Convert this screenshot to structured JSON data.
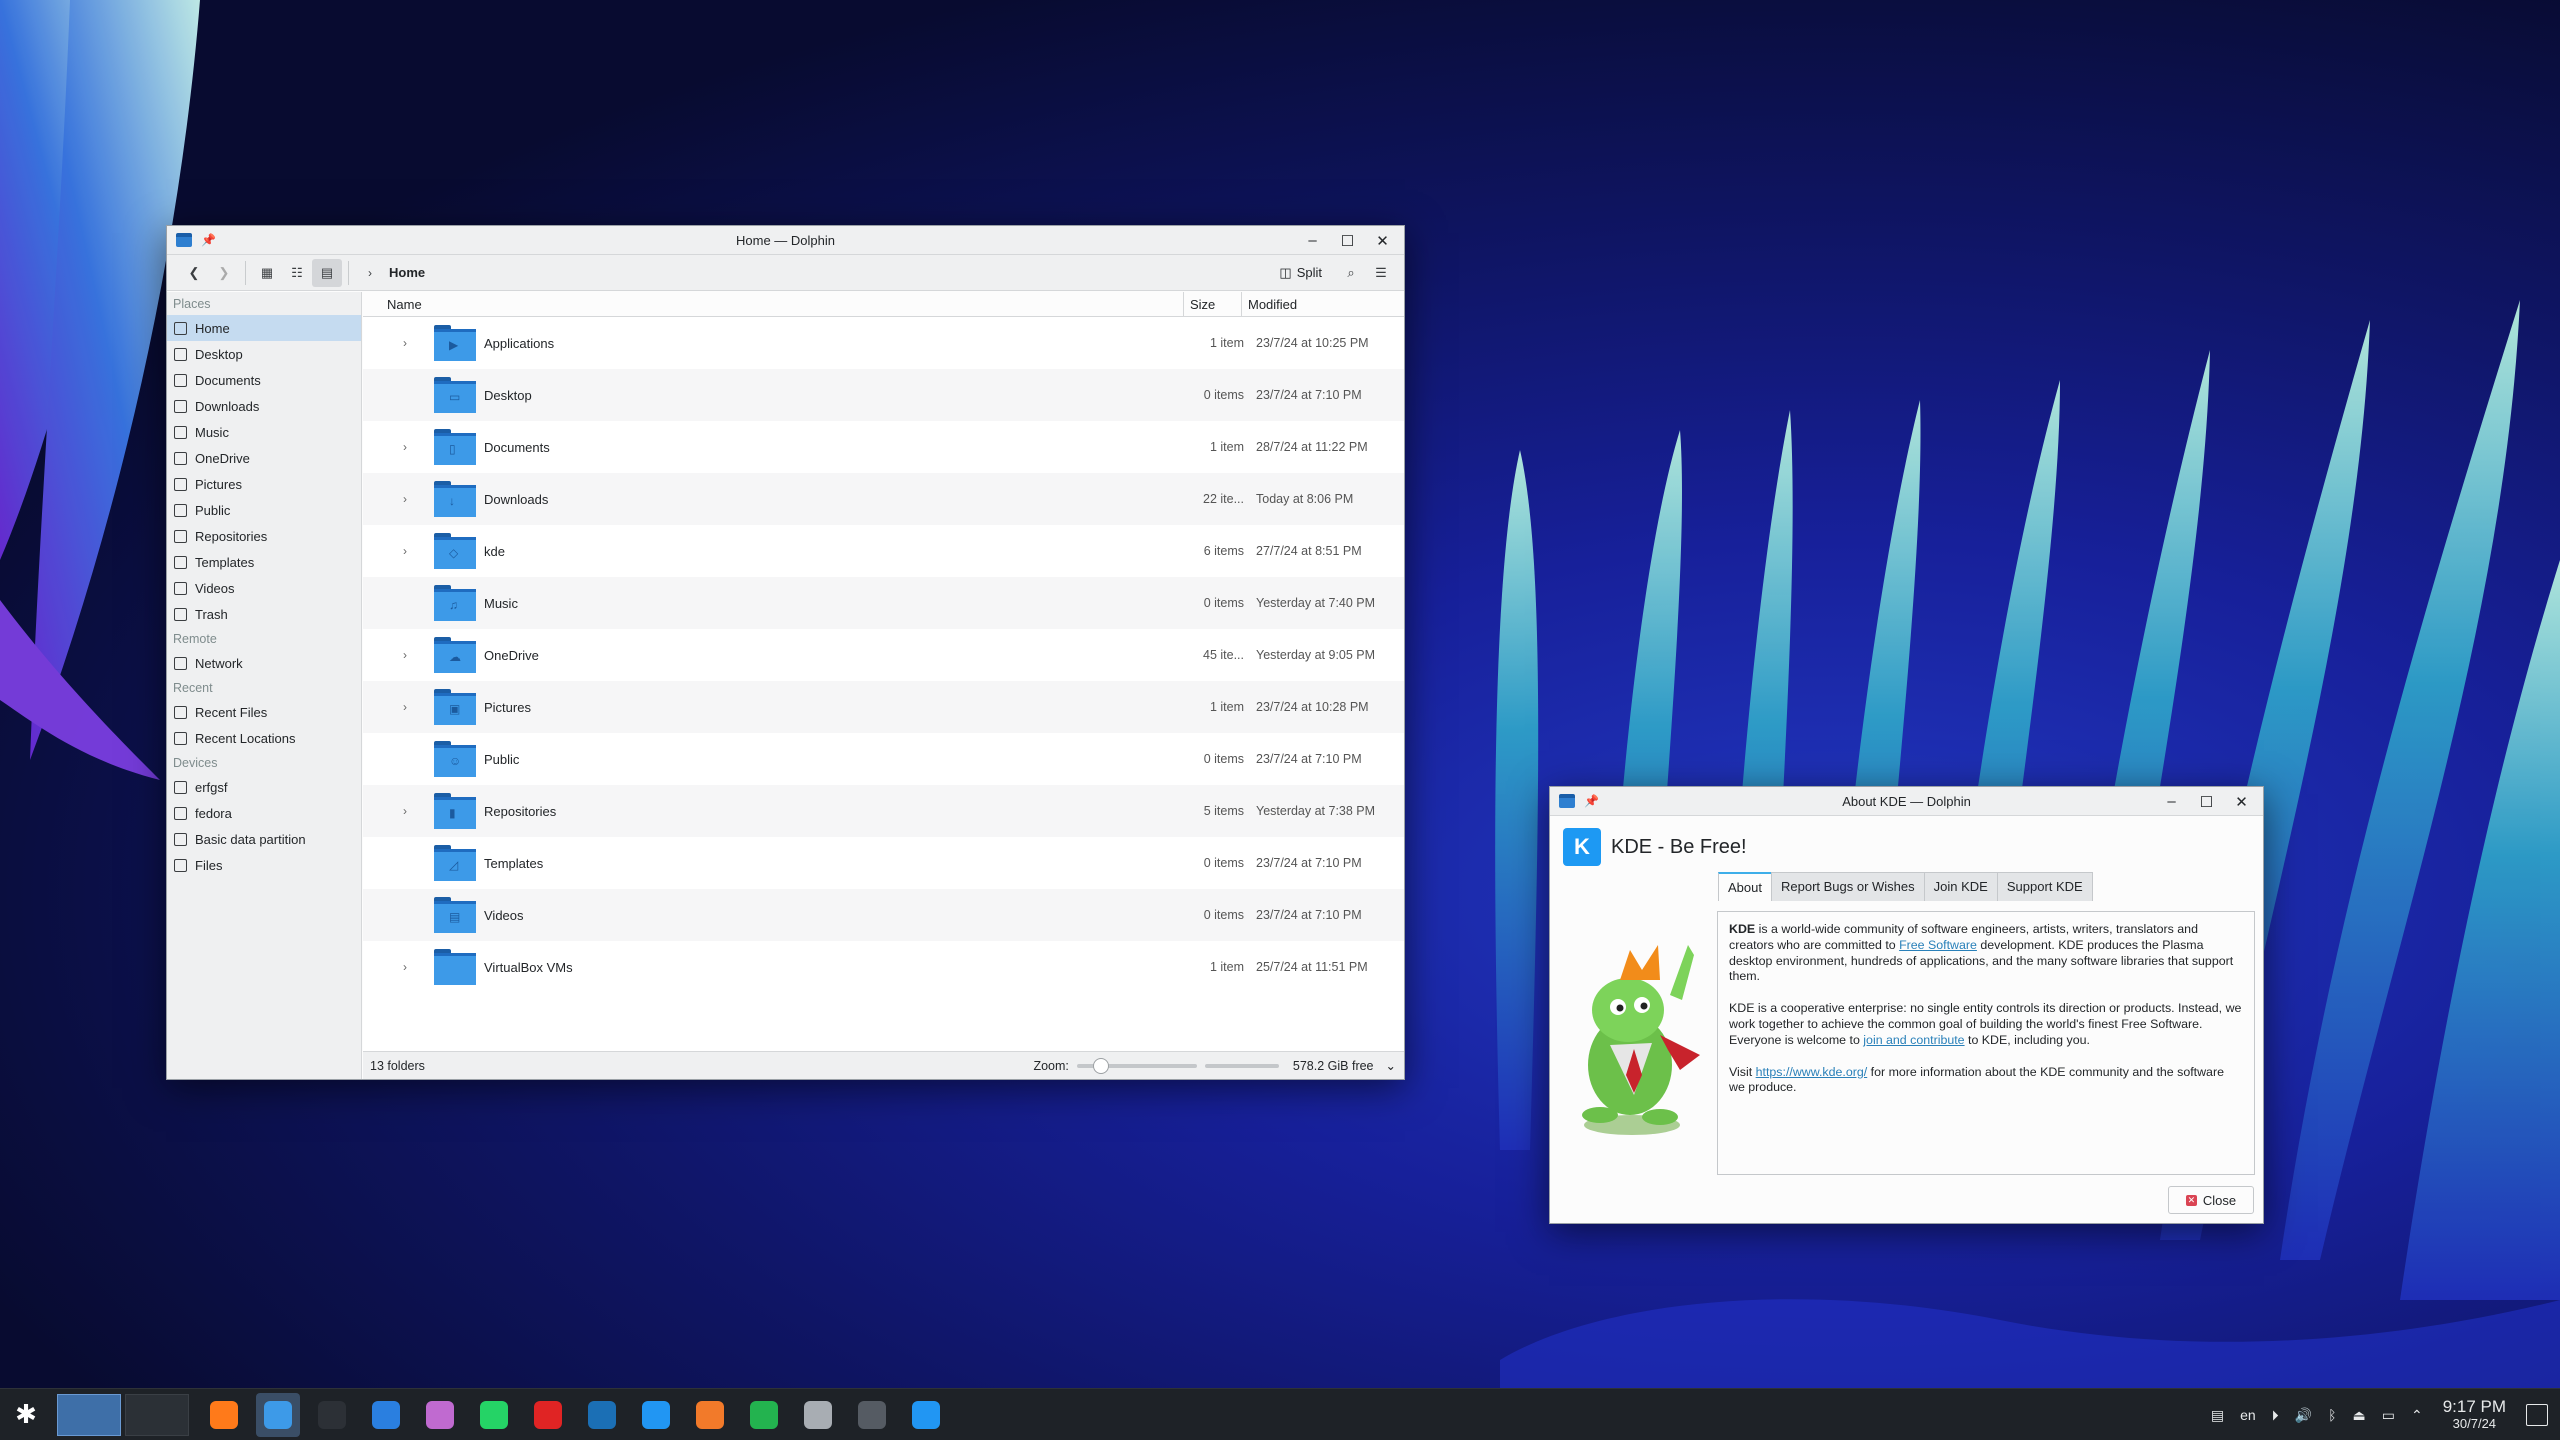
{
  "dolphin": {
    "title": "Home — Dolphin",
    "breadcrumb": "Home",
    "split_label": "Split",
    "places_header": "Places",
    "places": [
      {
        "label": "Home",
        "selected": true
      },
      {
        "label": "Desktop"
      },
      {
        "label": "Documents"
      },
      {
        "label": "Downloads"
      },
      {
        "label": "Music"
      },
      {
        "label": "OneDrive"
      },
      {
        "label": "Pictures"
      },
      {
        "label": "Public"
      },
      {
        "label": "Repositories"
      },
      {
        "label": "Templates"
      },
      {
        "label": "Videos"
      },
      {
        "label": "Trash"
      }
    ],
    "remote_header": "Remote",
    "remote": [
      {
        "label": "Network"
      }
    ],
    "recent_header": "Recent",
    "recent": [
      {
        "label": "Recent Files"
      },
      {
        "label": "Recent Locations"
      }
    ],
    "devices_header": "Devices",
    "devices": [
      {
        "label": "erfgsf"
      },
      {
        "label": "fedora"
      },
      {
        "label": "Basic data partition"
      },
      {
        "label": "Files"
      }
    ],
    "columns": {
      "name": "Name",
      "size": "Size",
      "modified": "Modified"
    },
    "files": [
      {
        "name": "Applications",
        "size": "1 item",
        "modified": "23/7/24 at 10:25 PM",
        "expandable": true,
        "glyph": "▶"
      },
      {
        "name": "Desktop",
        "size": "0 items",
        "modified": "23/7/24 at 7:10 PM",
        "expandable": false,
        "glyph": "▭"
      },
      {
        "name": "Documents",
        "size": "1 item",
        "modified": "28/7/24 at 11:22 PM",
        "expandable": true,
        "glyph": "▯"
      },
      {
        "name": "Downloads",
        "size": "22 ite...",
        "modified": "Today at 8:06 PM",
        "expandable": true,
        "glyph": "↓"
      },
      {
        "name": "kde",
        "size": "6 items",
        "modified": "27/7/24 at 8:51 PM",
        "expandable": true,
        "glyph": "◇"
      },
      {
        "name": "Music",
        "size": "0 items",
        "modified": "Yesterday at 7:40 PM",
        "expandable": false,
        "glyph": "♫"
      },
      {
        "name": "OneDrive",
        "size": "45 ite...",
        "modified": "Yesterday at 9:05 PM",
        "expandable": true,
        "glyph": "☁"
      },
      {
        "name": "Pictures",
        "size": "1 item",
        "modified": "23/7/24 at 10:28 PM",
        "expandable": true,
        "glyph": "▣"
      },
      {
        "name": "Public",
        "size": "0 items",
        "modified": "23/7/24 at 7:10 PM",
        "expandable": false,
        "glyph": "☺"
      },
      {
        "name": "Repositories",
        "size": "5 items",
        "modified": "Yesterday at 7:38 PM",
        "expandable": true,
        "glyph": "▮"
      },
      {
        "name": "Templates",
        "size": "0 items",
        "modified": "23/7/24 at 7:10 PM",
        "expandable": false,
        "glyph": "◿"
      },
      {
        "name": "Videos",
        "size": "0 items",
        "modified": "23/7/24 at 7:10 PM",
        "expandable": false,
        "glyph": "▤"
      },
      {
        "name": "VirtualBox VMs",
        "size": "1 item",
        "modified": "25/7/24 at 11:51 PM",
        "expandable": true,
        "glyph": ""
      }
    ],
    "status_count": "13 folders",
    "zoom_label": "Zoom:",
    "zoom_level": 0.15,
    "free_space": "578.2 GiB free"
  },
  "about": {
    "title": "About KDE — Dolphin",
    "heading": "KDE - Be Free!",
    "tabs": [
      "About",
      "Report Bugs or Wishes",
      "Join KDE",
      "Support KDE"
    ],
    "p1_bold": "KDE",
    "p1_a": " is a world-wide community of software engineers, artists, writers, translators and creators who are committed to ",
    "p1_link": "Free Software",
    "p1_b": " development. KDE produces the Plasma desktop environment, hundreds of applications, and the many software libraries that support them.",
    "p2_a": "KDE is a cooperative enterprise: no single entity controls its direction or products. Instead, we work together to achieve the common goal of building the world's finest Free Software. Everyone is welcome to ",
    "p2_link": "join and contribute",
    "p2_b": " to KDE, including you.",
    "p3_a": "Visit ",
    "p3_link": "https://www.kde.org/",
    "p3_b": " for more information about the KDE community and the software we produce.",
    "close_label": "Close"
  },
  "taskbar": {
    "apps": [
      {
        "name": "firefox-icon",
        "color": "#ff7a1a"
      },
      {
        "name": "dolphin-icon",
        "color": "#3d9ae8"
      },
      {
        "name": "konsole-icon",
        "color": "#2c3036"
      },
      {
        "name": "thunderbird-icon",
        "color": "#2a7fe0"
      },
      {
        "name": "color-app-icon",
        "color": "#c06ad0"
      },
      {
        "name": "whatsapp-icon",
        "color": "#25d366"
      },
      {
        "name": "youtube-music-icon",
        "color": "#e02424"
      },
      {
        "name": "steam-icon",
        "color": "#1b6fb5"
      },
      {
        "name": "document-icon",
        "color": "#2196f3"
      },
      {
        "name": "presentation-icon",
        "color": "#f27a2a"
      },
      {
        "name": "spreadsheet-icon",
        "color": "#23b34f"
      },
      {
        "name": "package-icon",
        "color": "#a8adb3"
      },
      {
        "name": "settings-icon",
        "color": "#555b63"
      },
      {
        "name": "store-icon",
        "color": "#2196f3"
      }
    ],
    "keyboard_layout": "en",
    "time": "9:17 PM",
    "date": "30/7/24"
  }
}
